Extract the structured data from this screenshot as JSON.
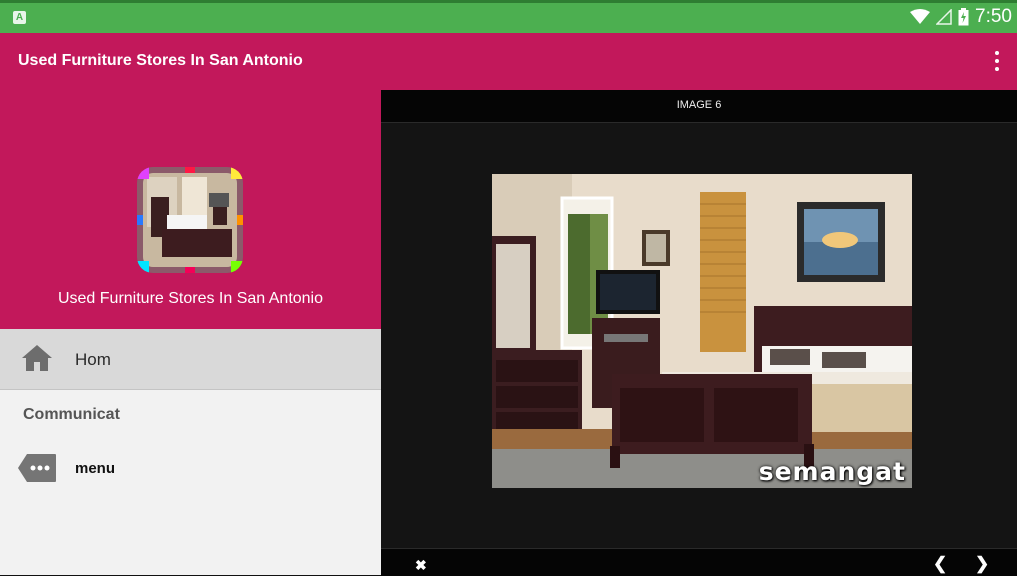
{
  "status_bar": {
    "time": "7:50",
    "icons": [
      "notification-a-icon",
      "wifi-icon",
      "signal-icon",
      "battery-charging-icon"
    ],
    "color": "#4caf50"
  },
  "app_bar": {
    "title": "Used Furniture Stores In San Antonio",
    "menu_icon": "overflow-menu-icon",
    "color": "#c2185b"
  },
  "drawer": {
    "header_title": "Used Furniture Stores In San Antonio",
    "items": [
      {
        "label": "Hom",
        "icon": "home-icon",
        "selected": true
      }
    ],
    "section_header": "Communicat",
    "section_items": [
      {
        "label": "menu",
        "icon": "more-tag-icon"
      }
    ]
  },
  "viewer": {
    "title": "IMAGE 6",
    "image_watermark": "semangat",
    "controls": {
      "close_icon": "close-icon",
      "prev_icon": "chevron-left-icon",
      "next_icon": "chevron-right-icon"
    }
  }
}
